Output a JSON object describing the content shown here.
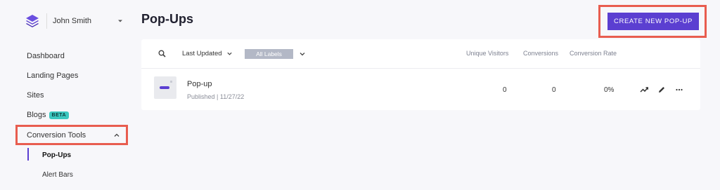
{
  "sidebar": {
    "user_name": "John Smith",
    "items": [
      {
        "label": "Dashboard"
      },
      {
        "label": "Landing Pages"
      },
      {
        "label": "Sites"
      },
      {
        "label": "Blogs",
        "badge": "BETA"
      },
      {
        "label": "Conversion Tools"
      }
    ],
    "sub_items": [
      {
        "label": "Pop-Ups",
        "active": true
      },
      {
        "label": "Alert Bars"
      }
    ]
  },
  "header": {
    "title": "Pop-Ups",
    "create_label": "CREATE NEW POP-UP"
  },
  "toolbar": {
    "sort_label": "Last Updated",
    "labels_filter": "All Labels"
  },
  "table": {
    "columns": [
      "Unique Visitors",
      "Conversions",
      "Conversion Rate"
    ],
    "rows": [
      {
        "name": "Pop-up",
        "meta": "Published | 11/27/22",
        "unique_visitors": "0",
        "conversions": "0",
        "conversion_rate": "0%"
      }
    ]
  },
  "colors": {
    "accent": "#5b3fd1",
    "highlight": "#e85d4f",
    "badge": "#3cc8c0"
  },
  "icons": [
    "logo-icon",
    "chevron-down-icon",
    "chevron-up-icon",
    "search-icon",
    "trend-icon",
    "pencil-icon",
    "more-icon"
  ]
}
